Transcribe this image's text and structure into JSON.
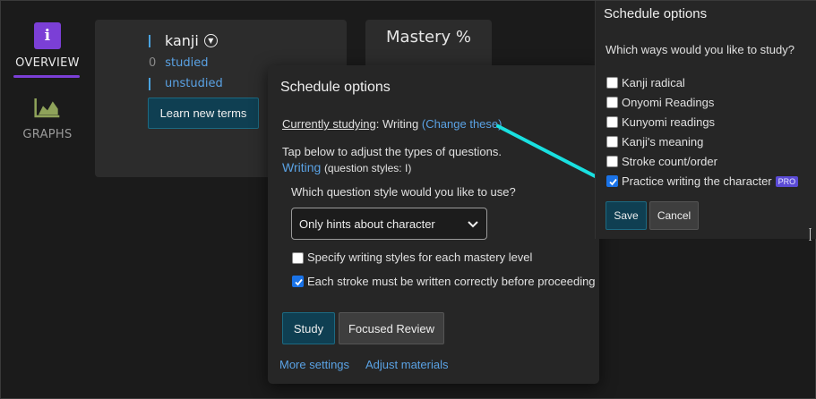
{
  "nav": {
    "overview_label": "OVERVIEW",
    "graphs_label": "GRAPHS",
    "overview_icon": "info-icon",
    "graphs_icon": "area-chart-icon"
  },
  "kanji_card": {
    "title": "kanji",
    "studied_count": "0",
    "studied_label": "studied",
    "unstudied_label": "unstudied",
    "learn_button": "Learn new terms"
  },
  "mastery_card": {
    "title": "Mastery %"
  },
  "modal": {
    "title": "Schedule options",
    "currently_studying_label": "Currently studying",
    "currently_studying_sep": ": ",
    "currently_studying_value": "Writing",
    "change_link": "(Change these)",
    "tap_text": "Tap below to adjust the types of questions.",
    "writing_label": "Writing",
    "question_styles_text": "(question styles: ",
    "question_styles_value": "I",
    "question_styles_close": ")",
    "style_question": "Which question style would you like to use?",
    "select_value": "Only hints about character",
    "specify_label": "Specify writing styles for each mastery level",
    "specify_checked": false,
    "stroke_label": "Each stroke must be written correctly before proceeding",
    "stroke_checked": true,
    "study_button": "Study",
    "focused_button": "Focused Review",
    "more_settings": "More settings",
    "adjust_materials": "Adjust materials"
  },
  "popover": {
    "title": "Schedule options",
    "question": "Which ways would you like to study?",
    "options": [
      {
        "label": "Kanji radical",
        "checked": false
      },
      {
        "label": "Onyomi Readings",
        "checked": false
      },
      {
        "label": "Kunyomi readings",
        "checked": false
      },
      {
        "label": "Kanji's meaning",
        "checked": false
      },
      {
        "label": "Stroke count/order",
        "checked": false
      },
      {
        "label": "Practice writing the character",
        "checked": true,
        "badge": "PRO"
      }
    ],
    "save_button": "Save",
    "cancel_button": "Cancel"
  },
  "colors": {
    "accent_purple": "#7b3fd6",
    "link_blue": "#5aa2e4",
    "primary_button": "#0f3f52",
    "pointer_line": "#19e0e0",
    "checkbox_blue": "#1a73e8"
  }
}
